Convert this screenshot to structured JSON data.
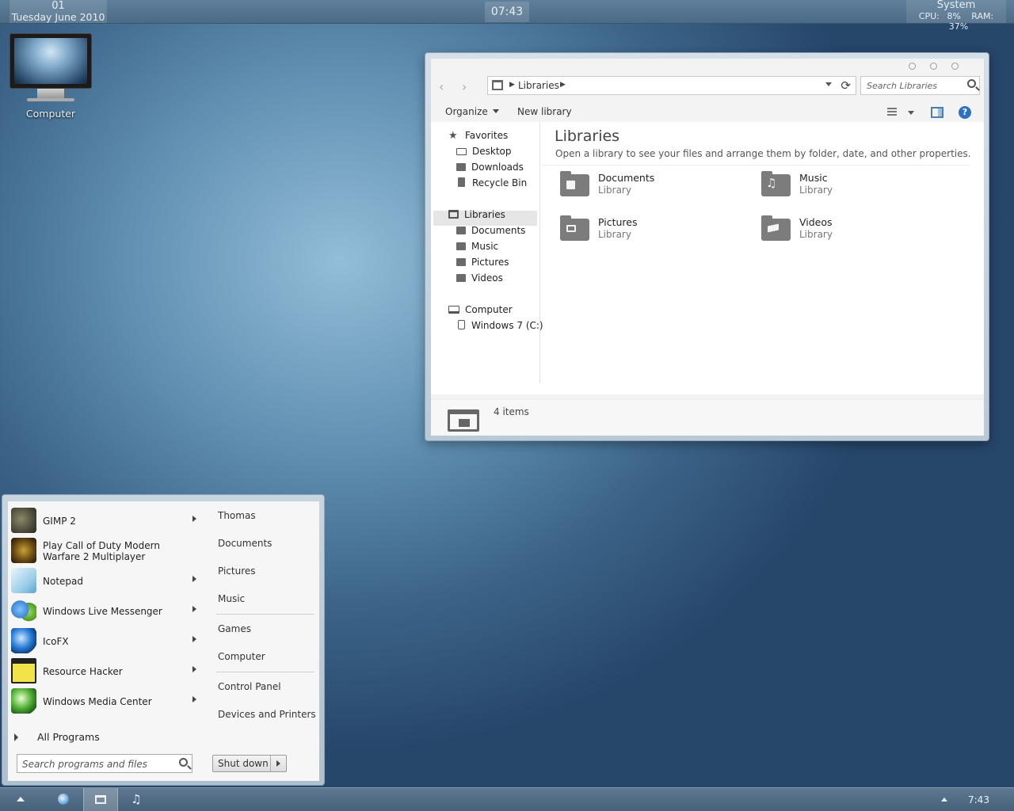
{
  "topbar": {
    "day": "01",
    "date": "Tuesday June 2010",
    "time": "07:43",
    "system_title": "System",
    "cpu_label": "CPU:",
    "cpu_value": "8%",
    "ram_label": "RAM:",
    "ram_value": "37%"
  },
  "desktop": {
    "icons": [
      {
        "label": "Computer",
        "icon": "monitor-icon"
      }
    ]
  },
  "explorer": {
    "breadcrumb": "Libraries",
    "search_placeholder": "Search Libraries",
    "commands": {
      "organize": "Organize",
      "new_library": "New library"
    },
    "nav": {
      "favorites": "Favorites",
      "desktop": "Desktop",
      "downloads": "Downloads",
      "recycle_bin": "Recycle Bin",
      "libraries": "Libraries",
      "documents": "Documents",
      "music": "Music",
      "pictures": "Pictures",
      "videos": "Videos",
      "computer": "Computer",
      "drive": "Windows 7 (C:)"
    },
    "title": "Libraries",
    "subtitle": "Open a library to see your files and arrange them by folder, date, and other properties.",
    "libraries": [
      {
        "name": "Documents",
        "type": "Library"
      },
      {
        "name": "Music",
        "type": "Library"
      },
      {
        "name": "Pictures",
        "type": "Library"
      },
      {
        "name": "Videos",
        "type": "Library"
      }
    ],
    "status": "4 items"
  },
  "start_menu": {
    "programs": [
      {
        "label": "GIMP 2",
        "has_submenu": true
      },
      {
        "label": "Play Call of Duty Modern Warfare 2 Multiplayer",
        "has_submenu": false
      },
      {
        "label": "Notepad",
        "has_submenu": true
      },
      {
        "label": "Windows Live Messenger",
        "has_submenu": true
      },
      {
        "label": "IcoFX",
        "has_submenu": true
      },
      {
        "label": "Resource Hacker",
        "has_submenu": true
      },
      {
        "label": "Windows Media Center",
        "has_submenu": true
      }
    ],
    "all_programs": "All Programs",
    "search_placeholder": "Search programs and files",
    "shutdown": "Shut down",
    "places": {
      "user": "Thomas",
      "documents": "Documents",
      "pictures": "Pictures",
      "music": "Music",
      "games": "Games",
      "computer": "Computer",
      "control_panel": "Control Panel",
      "devices": "Devices and Printers"
    }
  },
  "taskbar": {
    "clock": "7:43"
  }
}
